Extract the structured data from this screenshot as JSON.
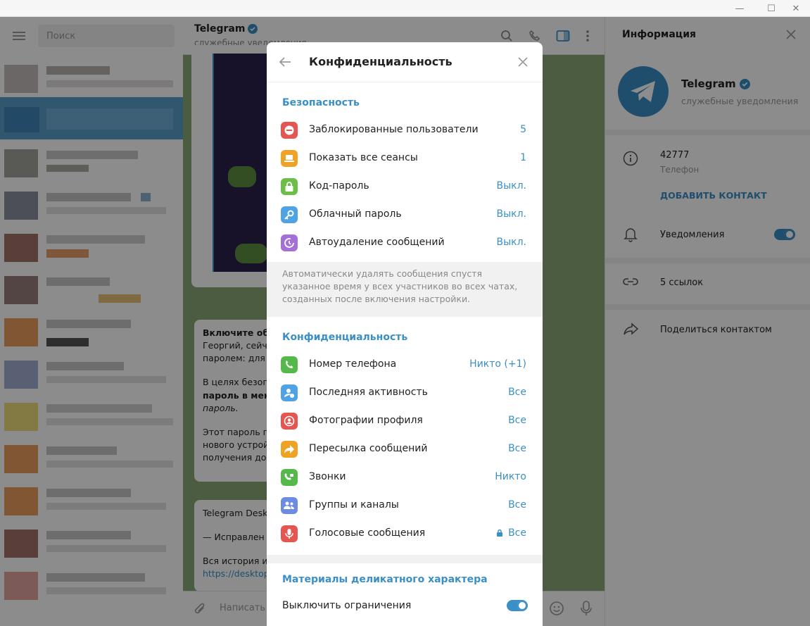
{
  "window": {
    "minimize_glyph": "—",
    "maximize_glyph": "☐",
    "close_glyph": "✕"
  },
  "search": {
    "placeholder": "Поиск"
  },
  "chat": {
    "name": "Telegram",
    "status": "служебные уведомления",
    "bubble1": {
      "bold_title": "Включите обл",
      "lines": [
        "Георгий, сейча",
        "паролем: для в",
        "",
        "В целях безопа",
        "пароль в мен",
        "пароль.",
        "",
        "Этот пароль по",
        "нового устрой",
        "получения дос"
      ]
    },
    "bubble2": {
      "lines": [
        "Telegram Deskt",
        "",
        "— Исправлен",
        "",
        "Вся история из",
        "https://desktop"
      ]
    },
    "composer_placeholder": "Написать со"
  },
  "info_panel": {
    "title": "Информация",
    "name": "Telegram",
    "status": "служебные уведомления",
    "phone": "42777",
    "phone_label": "Телефон",
    "add_contact": "ДОБАВИТЬ КОНТАКТ",
    "notifications": "Уведомления",
    "links": "5 ссылок",
    "share": "Поделиться контактом"
  },
  "modal": {
    "title": "Конфиденциальность",
    "security_title": "Безопасность",
    "security_items": [
      {
        "label": "Заблокированные пользователи",
        "value": "5",
        "icon": "blocked-icon",
        "color": "#e4564f"
      },
      {
        "label": "Показать все сеансы",
        "value": "1",
        "icon": "laptop-icon",
        "color": "#efa326"
      },
      {
        "label": "Код-пароль",
        "value": "Выкл.",
        "icon": "lock-icon",
        "color": "#6bbf46"
      },
      {
        "label": "Облачный пароль",
        "value": "Выкл.",
        "icon": "key-icon",
        "color": "#4fa3e4"
      },
      {
        "label": "Автоудаление сообщений",
        "value": "Выкл.",
        "icon": "timer-icon",
        "color": "#a56fd8"
      }
    ],
    "autodelete_note": "Автоматически удалять сообщения спустя указанное время у всех участников во всех чатах, созданных после включения настройки.",
    "privacy_title": "Конфиденциальность",
    "privacy_items": [
      {
        "label": "Номер телефона",
        "value": "Никто (+1)",
        "icon": "phone-icon",
        "color": "#55b84a"
      },
      {
        "label": "Последняя активность",
        "value": "Все",
        "icon": "user-clock-icon",
        "color": "#4fa3e4"
      },
      {
        "label": "Фотографии профиля",
        "value": "Все",
        "icon": "profile-photo-icon",
        "color": "#e4564f"
      },
      {
        "label": "Пересылка сообщений",
        "value": "Все",
        "icon": "forward-icon",
        "color": "#efa326"
      },
      {
        "label": "Звонки",
        "value": "Никто",
        "icon": "video-call-icon",
        "color": "#55b84a"
      },
      {
        "label": "Группы и каналы",
        "value": "Все",
        "icon": "group-icon",
        "color": "#6d8be0"
      },
      {
        "label": "Голосовые сообщения",
        "value": "Все",
        "icon": "microphone-icon",
        "color": "#e4564f"
      }
    ],
    "sensitive_title": "Материалы деликатного характера",
    "sensitive_toggle_label": "Выключить ограничения"
  },
  "colors": {
    "accent": "#3a8fc7",
    "chat_bg": "#8aa876"
  }
}
